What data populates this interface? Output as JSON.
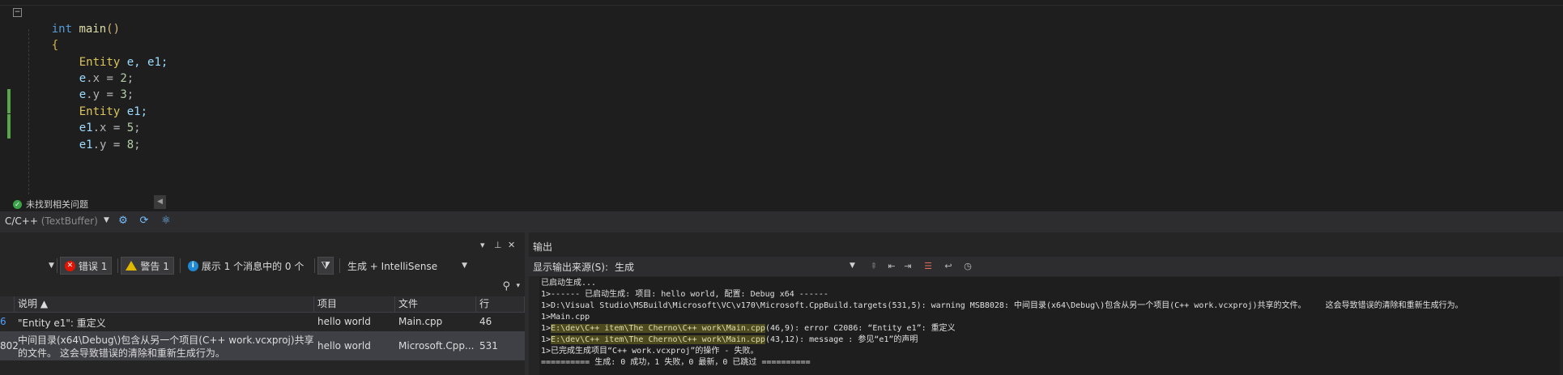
{
  "editor": {
    "fold_symbol": "−",
    "lines": [
      {
        "keyword": "int",
        "func": "main",
        "paren": "()"
      },
      {
        "brace": "{"
      },
      {
        "type": "Entity",
        "rest": " e, e1;"
      },
      {
        "var": "e",
        "op": ".x = ",
        "num": "2",
        "end": ";"
      },
      {
        "var": "e",
        "op": ".y = ",
        "num": "3",
        "end": ";"
      },
      {
        "type": "Entity",
        "rest": " e1;"
      },
      {
        "var": "e1",
        "op": ".x = ",
        "num": "5",
        "end": ";"
      },
      {
        "var": "e1",
        "op": ".y = ",
        "num": "8",
        "end": ";"
      }
    ],
    "issues_text": "未找到相关问题"
  },
  "navbar": {
    "language": "C/C++",
    "buffer": " (TextBuffer)"
  },
  "error_list": {
    "errors_label": "错误 1",
    "warnings_label": "警告 1",
    "messages_label": "展示 1 个消息中的 0 个",
    "build_filter": "生成 + IntelliSense",
    "headers": [
      "说明 ▲",
      "项目",
      "文件",
      "行"
    ],
    "rows": [
      {
        "code": "6",
        "description": "\"Entity e1\": 重定义",
        "description2": "",
        "project": "hello world",
        "file": "Main.cpp",
        "line": "46"
      },
      {
        "code": "802",
        "description": "中间目录(x64\\Debug\\)包含从另一个项目(C++ work.vcxproj)共享",
        "description2": "的文件。    这会导致错误的清除和重新生成行为。",
        "project": "hello world",
        "file": "Microsoft.Cpp...",
        "line": "531"
      }
    ]
  },
  "output": {
    "title": "输出",
    "source_label": "显示输出来源(S):",
    "source_value": "生成",
    "lines": [
      {
        "text": "已启动生成..."
      },
      {
        "text": "1>------ 已启动生成: 项目: hello world, 配置: Debug x64 ------"
      },
      {
        "text": "1>D:\\Visual Studio\\MSBuild\\Microsoft\\VC\\v170\\Microsoft.CppBuild.targets(531,5): warning MSB8028: 中间目录(x64\\Debug\\)包含从另一个项目(C++ work.vcxproj)共享的文件。    这会导致错误的清除和重新生成行为。"
      },
      {
        "text": "1>Main.cpp"
      },
      {
        "prefix": "1>",
        "link": "E:\\dev\\C++ item\\The Cherno\\C++ work\\Main.cpp",
        "text": "(46,9): error C2086: “Entity e1”: 重定义"
      },
      {
        "prefix": "1>",
        "link": "E:\\dev\\C++ item\\The Cherno\\C++ work\\Main.cpp",
        "text": "(43,12): message : 参见“e1”的声明"
      },
      {
        "text": "1>已完成生成项目“C++ work.vcxproj”的操作 - 失败。"
      },
      {
        "text": "========== 生成: 0 成功，1 失败，0 最新，0 已跳过 =========="
      }
    ]
  }
}
